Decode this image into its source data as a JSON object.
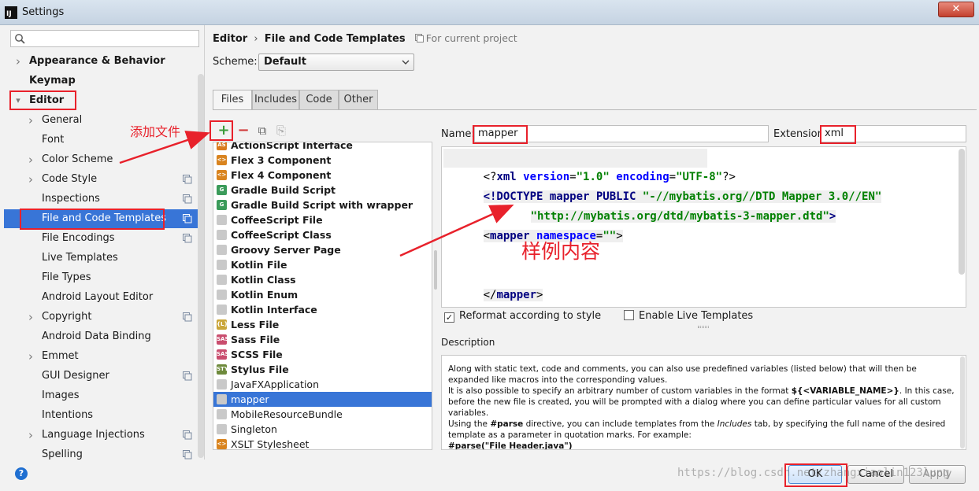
{
  "window": {
    "app_icon_text": "IJ",
    "title": "Settings",
    "close_glyph": "✕"
  },
  "sidebar": {
    "search": {
      "value": "",
      "placeholder": ""
    },
    "items": [
      {
        "label": "Appearance & Behavior",
        "bold": true,
        "arrow": ">"
      },
      {
        "label": "Keymap",
        "bold": true,
        "arrow": ""
      },
      {
        "label": "Editor",
        "bold": true,
        "arrow": "v"
      },
      {
        "label": "General",
        "arrow": ">"
      },
      {
        "label": "Font",
        "arrow": ""
      },
      {
        "label": "Color Scheme",
        "arrow": ">"
      },
      {
        "label": "Code Style",
        "arrow": ">"
      },
      {
        "label": "Inspections",
        "arrow": ""
      },
      {
        "label": "File and Code Templates",
        "arrow": "",
        "selected": true
      },
      {
        "label": "File Encodings",
        "arrow": ""
      },
      {
        "label": "Live Templates",
        "arrow": ""
      },
      {
        "label": "File Types",
        "arrow": ""
      },
      {
        "label": "Android Layout Editor",
        "arrow": ""
      },
      {
        "label": "Copyright",
        "arrow": ">"
      },
      {
        "label": "Android Data Binding",
        "arrow": ""
      },
      {
        "label": "Emmet",
        "arrow": ">"
      },
      {
        "label": "GUI Designer",
        "arrow": ""
      },
      {
        "label": "Images",
        "arrow": ""
      },
      {
        "label": "Intentions",
        "arrow": ""
      },
      {
        "label": "Language Injections",
        "arrow": ">"
      },
      {
        "label": "Spelling",
        "arrow": ""
      }
    ]
  },
  "header": {
    "crumb_editor": "Editor",
    "crumb_sep": "›",
    "crumb_page": "File and Code Templates",
    "project_note": "For current project",
    "scheme_label": "Scheme:",
    "scheme_value": "Default"
  },
  "tabs": [
    "Files",
    "Includes",
    "Code",
    "Other"
  ],
  "toolbar": {
    "add": "+",
    "remove": "−",
    "copy": "⧉",
    "reset": "⎘"
  },
  "templates": [
    {
      "label": "ActionScript Interface",
      "badge": "AS",
      "color": "#d97b1f"
    },
    {
      "label": "Flex 3 Component",
      "badge": "<>",
      "color": "#d9841f"
    },
    {
      "label": "Flex 4 Component",
      "badge": "<>",
      "color": "#d9841f"
    },
    {
      "label": "Gradle Build Script",
      "badge": "G",
      "color": "#3b9b5a"
    },
    {
      "label": "Gradle Build Script with wrapper",
      "badge": "G",
      "color": "#3b9b5a"
    },
    {
      "label": "CoffeeScript File",
      "badge": "",
      "color": "#c9c9c9"
    },
    {
      "label": "CoffeeScript Class",
      "badge": "",
      "color": "#c9c9c9"
    },
    {
      "label": "Groovy Server Page",
      "badge": "",
      "color": "#c9c9c9"
    },
    {
      "label": "Kotlin File",
      "badge": "",
      "color": "#c9c9c9"
    },
    {
      "label": "Kotlin Class",
      "badge": "",
      "color": "#c9c9c9"
    },
    {
      "label": "Kotlin Enum",
      "badge": "",
      "color": "#c9c9c9"
    },
    {
      "label": "Kotlin Interface",
      "badge": "",
      "color": "#c9c9c9"
    },
    {
      "label": "Less File",
      "badge": "{L}",
      "color": "#caa63a"
    },
    {
      "label": "Sass File",
      "badge": "SASS",
      "color": "#c94d6e"
    },
    {
      "label": "SCSS File",
      "badge": "SASS",
      "color": "#c94d6e"
    },
    {
      "label": "Stylus File",
      "badge": "STYL",
      "color": "#6e8a3c"
    },
    {
      "label": "JavaFXApplication",
      "badge": "",
      "color": "#c9c9c9"
    },
    {
      "label": "mapper",
      "badge": "",
      "color": "#c9c9c9",
      "selected": true
    },
    {
      "label": "MobileResourceBundle",
      "badge": "",
      "color": "#c9c9c9"
    },
    {
      "label": "Singleton",
      "badge": "",
      "color": "#c9c9c9"
    },
    {
      "label": "XSLT Stylesheet",
      "badge": "<>",
      "color": "#d9841f"
    }
  ],
  "form": {
    "name_label": "Name:",
    "name_value": "mapper",
    "ext_label": "Extension:",
    "ext_value": "xml"
  },
  "code": {
    "l1_open": "<?",
    "l1_tag": "xml",
    "l1_attr1": " version",
    "l1_eq1": "=",
    "l1_val1": "\"1.0\"",
    "l1_attr2": " encoding",
    "l1_eq2": "=",
    "l1_val2": "\"UTF-8\"",
    "l1_close": "?>",
    "l2_tag": "<!DOCTYPE",
    "l2_rest": " mapper PUBLIC ",
    "l2_str": "\"-//mybatis.org//DTD Mapper 3.0//EN\"",
    "l3_str": "\"http://mybatis.org/dtd/mybatis-3-mapper.dtd\"",
    "l3_close": ">",
    "l4_open": "<",
    "l4_tag": "mapper",
    "l4_attr": " namespace",
    "l4_eq": "=",
    "l4_val": "\"\"",
    "l4_close": ">",
    "l5_open": "</",
    "l5_tag": "mapper",
    "l5_close": ">"
  },
  "options": {
    "reformat_label": "Reformat according to style",
    "reformat_checked": true,
    "live_label": "Enable Live Templates",
    "live_checked": false
  },
  "description": {
    "label": "Description",
    "p1": "Along with static text, code and comments, you can also use predefined variables (listed below) that will then be expanded like macros into the corresponding values.",
    "p2a": "It is also possible to specify an arbitrary number of custom variables in the format ",
    "p2b": "${<VARIABLE_NAME>}",
    "p2c": ". In this case, before the new file is created, you will be prompted with a dialog where you can define particular values for all custom variables.",
    "p3a": "Using the ",
    "p3b": "#parse",
    "p3c": " directive, you can include templates from the ",
    "p3d": "Includes",
    "p3e": " tab, by specifying the full name of the desired template as a parameter in quotation marks. For example:",
    "p4": "#parse(\"File Header.java\")"
  },
  "buttons": {
    "help": "?",
    "ok": "OK",
    "cancel": "Cancel",
    "apply": "Apply"
  },
  "annotations": {
    "add_file": "添加文件",
    "sample": "样例内容",
    "accent": "#e8212b"
  },
  "watermark": "https://blog.csdn.net/zhangxiaolin123lung"
}
